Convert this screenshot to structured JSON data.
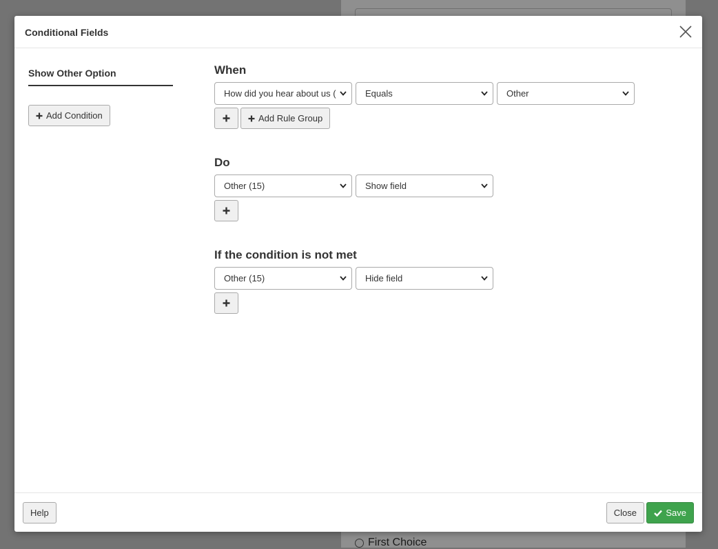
{
  "modal": {
    "title": "Conditional Fields"
  },
  "sidebar": {
    "tab_label": "Show Other Option",
    "add_condition_label": "Add Condition"
  },
  "when": {
    "title": "When",
    "field": "How did you hear about us (",
    "operator": "Equals",
    "value": "Other",
    "add_rule_group_label": "Add Rule Group"
  },
  "do": {
    "title": "Do",
    "field": "Other (15)",
    "action": "Show field"
  },
  "else": {
    "title": "If the condition is not met",
    "field": "Other (15)",
    "action": "Hide field"
  },
  "footer": {
    "help_label": "Help",
    "close_label": "Close",
    "save_label": "Save"
  },
  "background": {
    "choice_label": "First Choice"
  },
  "colors": {
    "save": "#3fa34d",
    "overlay": "#737373"
  }
}
